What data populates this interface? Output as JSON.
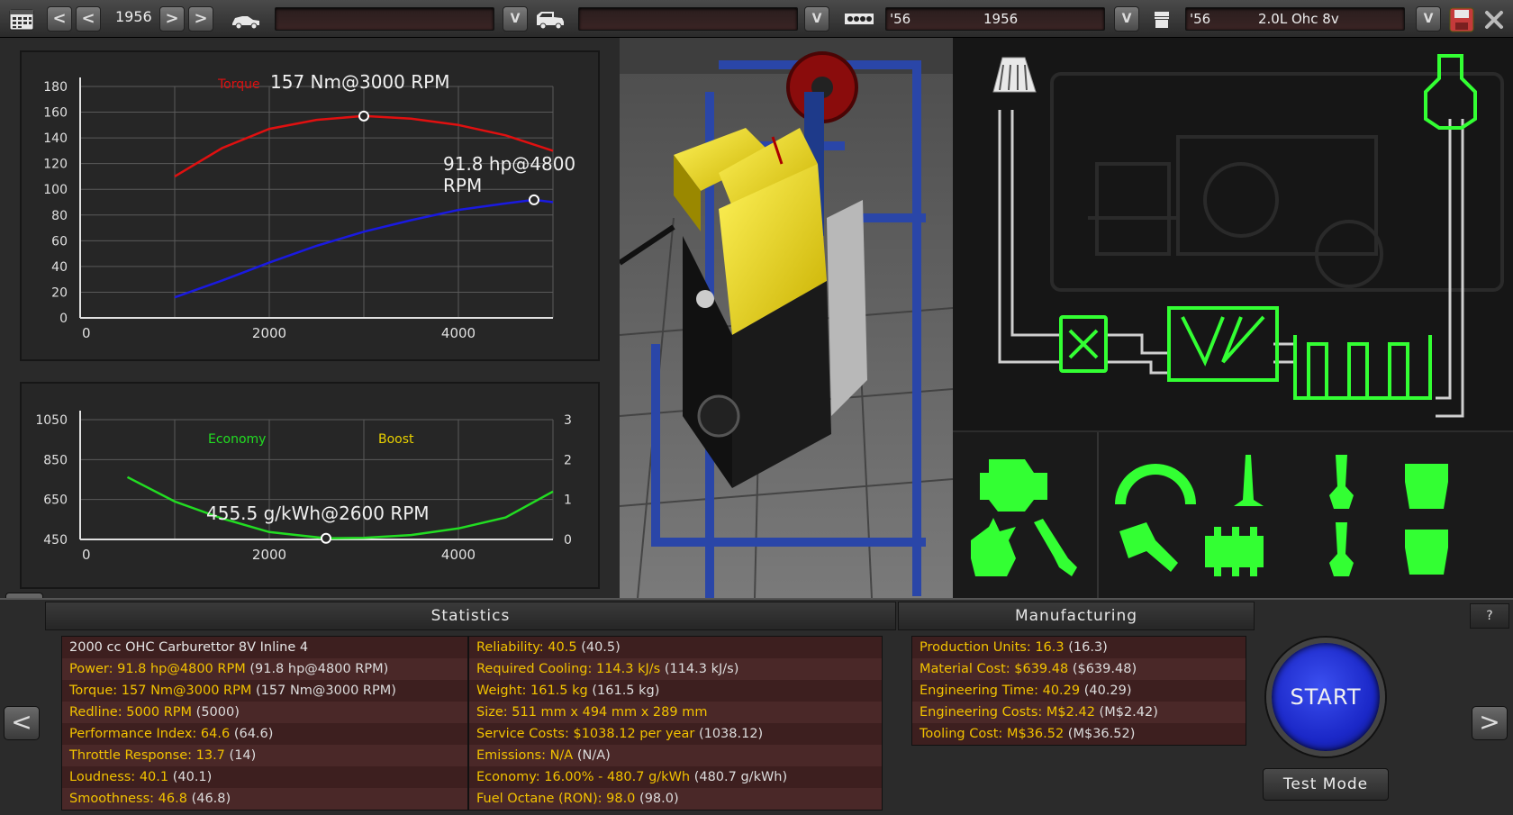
{
  "topbar": {
    "year_value": "1956",
    "car_model_field": "",
    "car_trim_field": "",
    "engine_family_year": "'56",
    "engine_family_name": "1956",
    "engine_variant_year": "'56",
    "engine_variant_name": "2.0L Ohc 8v",
    "prev_label": "<",
    "next_label": ">",
    "dropdown_label": "V"
  },
  "torque_chart": {
    "torque_legend": "Torque",
    "torque_peak_label": "157 Nm@3000 RPM",
    "power_peak_label": "91.8 hp@4800 RPM"
  },
  "economy_chart": {
    "economy_legend": "Economy",
    "boost_legend": "Boost",
    "economy_peak_label": "455.5 g/kWh@2600 RPM"
  },
  "chart_data": [
    {
      "type": "line",
      "x_ticks": [
        "0",
        "2000",
        "4000"
      ],
      "y_ticks": [
        "0",
        "20",
        "40",
        "60",
        "80",
        "100",
        "120",
        "140",
        "160",
        "180"
      ],
      "xlim": [
        0,
        5000
      ],
      "ylim": [
        0,
        180
      ],
      "grid": true,
      "series": [
        {
          "name": "Torque",
          "color": "#e01010",
          "x": [
            1000,
            1500,
            2000,
            2500,
            3000,
            3500,
            4000,
            4500,
            5000
          ],
          "y": [
            110,
            132,
            147,
            154,
            157,
            155,
            150,
            142,
            130
          ]
        },
        {
          "name": "Power",
          "color": "#1a1ae0",
          "x": [
            1000,
            1500,
            2000,
            2500,
            3000,
            3500,
            4000,
            4500,
            4800,
            5000
          ],
          "y": [
            16,
            29,
            43,
            56,
            67,
            76,
            84,
            89,
            91.8,
            90
          ]
        }
      ],
      "markers": [
        {
          "x": 3000,
          "y": 157
        },
        {
          "x": 4800,
          "y": 91.8
        }
      ]
    },
    {
      "type": "line",
      "x_ticks": [
        "0",
        "2000",
        "4000"
      ],
      "y_ticks": [
        "450",
        "650",
        "850",
        "1050"
      ],
      "y2_ticks": [
        "0",
        "1",
        "2",
        "3"
      ],
      "xlim": [
        0,
        5000
      ],
      "ylim": [
        450,
        1050
      ],
      "y2lim": [
        0,
        3
      ],
      "grid": true,
      "series": [
        {
          "name": "Economy",
          "color": "#22dd22",
          "x": [
            500,
            1000,
            1500,
            2000,
            2600,
            3000,
            3500,
            4000,
            4500,
            5000
          ],
          "y": [
            762,
            640,
            555,
            487,
            455.5,
            458,
            472,
            505,
            560,
            690
          ]
        }
      ],
      "markers": [
        {
          "x": 2600,
          "y": 455.5
        }
      ]
    }
  ],
  "statistics": {
    "title": "Statistics",
    "header_line": "2000 cc OHC Carburettor 8V Inline 4",
    "left": [
      {
        "label": "Power:",
        "value": "91.8 hp@4800 RPM",
        "prev": "(91.8 hp@4800 RPM)"
      },
      {
        "label": "Torque:",
        "value": "157 Nm@3000 RPM",
        "prev": "(157 Nm@3000 RPM)"
      },
      {
        "label": "Redline:",
        "value": "5000 RPM",
        "prev": "(5000)"
      },
      {
        "label": "Performance Index:",
        "value": "64.6",
        "prev": "(64.6)"
      },
      {
        "label": "Throttle Response:",
        "value": "13.7",
        "prev": "(14)"
      },
      {
        "label": "Loudness:",
        "value": "40.1",
        "prev": "(40.1)"
      },
      {
        "label": "Smoothness:",
        "value": "46.8",
        "prev": "(46.8)"
      }
    ],
    "right": [
      {
        "label": "Reliability:",
        "value": "40.5",
        "prev": "(40.5)"
      },
      {
        "label": "Required Cooling:",
        "value": "114.3 kJ/s",
        "prev": "(114.3 kJ/s)"
      },
      {
        "label": "Weight:",
        "value": "161.5 kg",
        "prev": "(161.5 kg)"
      },
      {
        "label": "Size:",
        "value": "511 mm x 494 mm x 289 mm",
        "prev": ""
      },
      {
        "label": "Service Costs:",
        "value": "$1038.12 per year",
        "prev": "(1038.12)"
      },
      {
        "label": "Emissions:",
        "value": "N/A",
        "prev": "(N/A)"
      },
      {
        "label": "Economy:",
        "value": "16.00% - 480.7 g/kWh",
        "prev": "(480.7 g/kWh)"
      },
      {
        "label": "Fuel Octane (RON):",
        "value": "98.0",
        "prev": "(98.0)"
      }
    ]
  },
  "manufacturing": {
    "title": "Manufacturing",
    "rows": [
      {
        "label": "Production Units:",
        "value": "16.3",
        "prev": "(16.3)"
      },
      {
        "label": "Material Cost:",
        "value": "$639.48",
        "prev": "($639.48)"
      },
      {
        "label": "Engineering Time:",
        "value": "40.29",
        "prev": "(40.29)"
      },
      {
        "label": "Engineering Costs:",
        "value": "M$2.42",
        "prev": "(M$2.42)"
      },
      {
        "label": "Tooling Cost:",
        "value": "M$36.52",
        "prev": "(M$36.52)"
      }
    ]
  },
  "actions": {
    "start_label": "START",
    "test_mode_label": "Test Mode",
    "help_label": "?",
    "back_label": "<",
    "forward_label": ">"
  },
  "icons": {
    "calendar": "calendar-icon",
    "car": "car-icon",
    "van": "van-icon",
    "engine_block": "engine-block-icon",
    "piston": "piston-icon",
    "save": "save-icon",
    "close": "close-icon"
  },
  "colors": {
    "schematic_green": "#33ff33",
    "stat_yellow": "#f2c200",
    "start_blue": "#1b28c8"
  }
}
